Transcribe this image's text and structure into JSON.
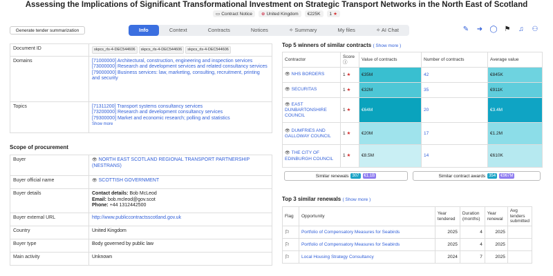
{
  "page": {
    "title": "Assessing the Implications of Significant Transformational Investment on Strategic Transport Networks in the North East of Scotland",
    "chips": [
      {
        "icon": "contract-notice-icon",
        "label": "Contract Notice"
      },
      {
        "icon": "uk-flag-icon",
        "label": "United Kingdom"
      },
      {
        "icon": "",
        "label": "€225K"
      },
      {
        "icon": "star-icon",
        "label": "1"
      }
    ],
    "generate_button": "Generate tender summarization"
  },
  "tabs": [
    "Info",
    "Context",
    "Contracts",
    "Notices",
    "Summary",
    "My files",
    "AI Chat"
  ],
  "tabs_active": 0,
  "toolbar_icons": [
    "edit-icon",
    "share-icon",
    "comment-icon",
    "flag-icon",
    "bell-icon",
    "add-user-icon"
  ],
  "info": {
    "doc_id_label": "Document ID",
    "doc_ids": [
      "skpcs_rls-4-DEC544606",
      "skpcs_rls-4-DEC544606",
      "skpcs_rls-4-DEC544606"
    ],
    "domains_label": "Domains",
    "domains": [
      "[71000000] Architectural, construction, engineering and inspection services",
      "[73000000] Research and development services and related consultancy services",
      "[79000000] Business services: law, marketing, consulting, recruitment, printing and security"
    ],
    "topics_label": "Topics",
    "topics": [
      "[71311200] Transport systems consultancy services",
      "[73200000] Research and development consultancy services",
      "[79300000] Market and economic research; polling and statistics"
    ],
    "show_more": "Show more"
  },
  "scope": {
    "title": "Scope of procurement",
    "buyer_label": "Buyer",
    "buyer": "NORTH EAST SCOTLAND REGIONAL TRANSPORT PARTNERSHIP (NESTRANS)",
    "official_label": "Buyer official name",
    "official": "SCOTTISH GOVERNMENT",
    "details_label": "Buyer details",
    "contact_key": "Contact details:",
    "contact_val": "Bob McLeod",
    "email_key": "Email:",
    "email_val": "bob.mcleod@gov.scot",
    "phone_key": "Phone:",
    "phone_val": "+44 1312442500",
    "url_label": "Buyer external URL",
    "url": "http://www.publiccontractsscotland.gov.uk",
    "country_label": "Country",
    "country": "United Kingdom",
    "type_label": "Buyer type",
    "type": "Body governed by public law",
    "activity_label": "Main activity",
    "activity": "Unknown"
  },
  "winners": {
    "title": "Top 5 winners of similar contracts",
    "show_more": "( Show more )",
    "headers": [
      "Contractor",
      "Score",
      "Value of contracts",
      "Number of contracts",
      "Average value"
    ],
    "rows": [
      {
        "name": "NHS BORDERS",
        "score": "1",
        "value": "€35M",
        "count": "42",
        "avg": "€845K",
        "value_color": "#39bfd0",
        "avg_color": "#6ed3e0"
      },
      {
        "name": "SECURITAS",
        "score": "1",
        "value": "€32M",
        "count": "35",
        "avg": "€911K",
        "value_color": "#4ec7d6",
        "avg_color": "#5fcddc"
      },
      {
        "name": "EAST DUNBARTONSHIRE COUNCIL",
        "score": "1",
        "value": "€64M",
        "count": "20",
        "avg": "€3.4M",
        "value_color": "#0aa3bd",
        "avg_color": "#0fa4c4"
      },
      {
        "name": "DUMFRIES AND GALLOWAY COUNCIL",
        "score": "1",
        "value": "€20M",
        "count": "17",
        "avg": "€1.2M",
        "value_color": "#9fe3ec",
        "avg_color": "#8cdde8"
      },
      {
        "name": "THE CITY OF EDINBURGH COUNCIL",
        "score": "1",
        "value": "€8.5M",
        "count": "14",
        "avg": "€610K",
        "value_color": "#c9eff4",
        "avg_color": "#b6e9f0"
      }
    ]
  },
  "summary": {
    "renewals_label": "Similar renewals",
    "renewals_count": "307",
    "renewals_value": "€1.1B",
    "awards_label": "Similar contract awards",
    "awards_count": "354",
    "awards_value": "€967M"
  },
  "renewals": {
    "title": "Top 3 similar renewals",
    "show_more": "( Show more )",
    "headers": [
      "Flag",
      "Opportunity",
      "Year tendered",
      "Duration (months)",
      "Year renewal",
      "Avg tenders submitted"
    ],
    "rows": [
      {
        "opportunity": "Portfolio of Compensatory Measures for Seabirds",
        "year": "2025",
        "duration": "4",
        "renewal": "2025",
        "avg": ""
      },
      {
        "opportunity": "Portfolio of Compensatory Measures for Seabirds",
        "year": "2025",
        "duration": "4",
        "renewal": "2025",
        "avg": ""
      },
      {
        "opportunity": "Local Housing Strategy Consultancy",
        "year": "2024",
        "duration": "7",
        "renewal": "2025",
        "avg": ""
      }
    ]
  }
}
